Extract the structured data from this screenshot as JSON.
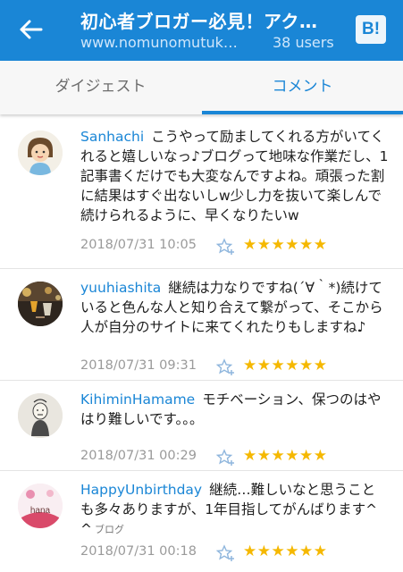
{
  "header": {
    "title": "初心者ブロガー必見！アク…",
    "url": "www.nomunomutuk…",
    "users": "38 users",
    "bookmark_label": "B!"
  },
  "tabs": [
    {
      "label": "ダイジェスト",
      "active": false
    },
    {
      "label": "コメント",
      "active": true
    }
  ],
  "comments": [
    {
      "user": "Sanhachi",
      "text": "こうやって励ましてくれる方がいてくれると嬉しいなっ♪ブログって地味な作業だし、1記事書くだけでも大変なんですよね。頑張った割に結果はすぐ出ないしw少し力を抜いて楽しんで続けられるように、早くなりたいw",
      "date": "2018/07/31 10:05",
      "stars": "★★★★★★",
      "tag": ""
    },
    {
      "user": "yuuhiashita",
      "text": "継続は力なりですね(´∀｀*)続けていると色んな人と知り合えて繋がって、そこから人が自分のサイトに来てくれたりもしますね♪",
      "date": "2018/07/31 09:31",
      "stars": "★★★★★★",
      "tag": ""
    },
    {
      "user": "KihiminHamame",
      "text": "モチベーション、保つのはやはり難しいです。。。",
      "date": "2018/07/31 00:29",
      "stars": "★★★★★★",
      "tag": ""
    },
    {
      "user": "HappyUnbirthday",
      "text": "継続…難しいなと思うことも多々ありますが、1年目指してがんばります^ ^",
      "date": "2018/07/31 00:18",
      "stars": "★★★★★★",
      "tag": "ブログ",
      "avatar_text": "hana"
    }
  ],
  "colors": {
    "accent": "#1a86d6",
    "star": "#f5b800",
    "date": "#9a9a9a"
  },
  "icons": {
    "back": "arrow-left-icon",
    "bookmark": "hatena-bookmark-icon",
    "star_add": "star-plus-icon"
  }
}
